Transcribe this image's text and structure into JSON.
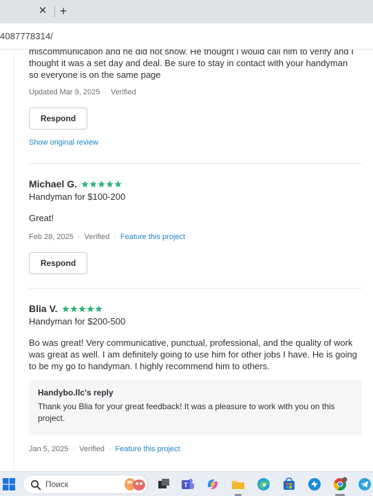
{
  "browser": {
    "tab_close": "✕",
    "new_tab": "+",
    "address": "4087778314/"
  },
  "reviews": {
    "prev": {
      "text": "miscommunication and he did not show. He thought I would call him to verify and I thought it was a set day and deal. Be sure to stay in contact with your handyman so everyone is on the same page",
      "date": "Updated Mar 9, 2025",
      "verified": "Verified",
      "respond": "Respond",
      "original_link": "Show original review"
    },
    "michael": {
      "name": "Michael G.",
      "rating": 5,
      "service": "Handyman for $100-200",
      "text": "Great!",
      "date": "Feb 28, 2025",
      "verified": "Verified",
      "feature": "Feature this project",
      "respond": "Respond"
    },
    "blia": {
      "name": "Blia V.",
      "rating": 5,
      "service": "Handyman for $200-500",
      "text": "Bo was great! Very communicative, punctual, professional, and the quality of work was great as well. I am definitely going to use him for other jobs I have. He is going to be my go to handyman. I highly recommend him to others.",
      "reply_title": "Handybo.llc's reply",
      "reply_text": "Thank you Blia for your great feedback! It was a pleasure to work with you on this project.",
      "date": "Jan 5, 2025",
      "verified": "Verified",
      "feature": "Feature this project"
    }
  },
  "taskbar": {
    "search_placeholder": "Поиск",
    "icons": [
      "windows-start-icon",
      "search-icon",
      "task-view-icon",
      "teams-icon",
      "copilot-icon",
      "file-explorer-icon",
      "edge-icon",
      "store-icon",
      "app-icon",
      "chrome-icon",
      "telegram-icon"
    ]
  },
  "colors": {
    "star": "#2db67c",
    "link": "#1e83c8",
    "text": "#2f3033"
  }
}
